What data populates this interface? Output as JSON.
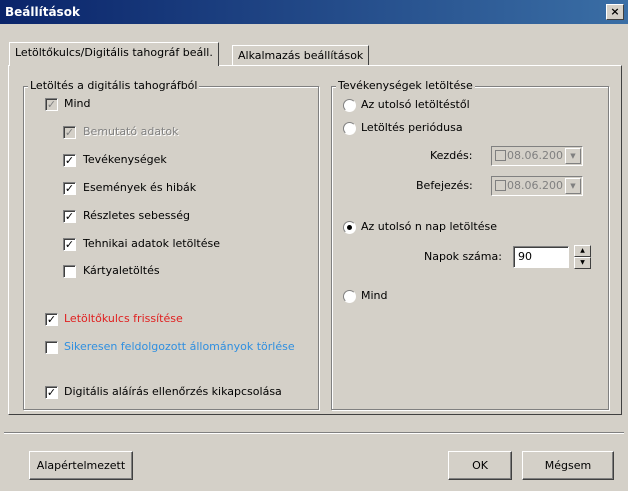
{
  "window": {
    "title": "Beállítások",
    "close_glyph": "×"
  },
  "tabs": [
    {
      "label": "Letöltőkulcs/Digitális tahográf beáll."
    },
    {
      "label": "Alkalmazás beállítások"
    }
  ],
  "left_group": {
    "legend": "Letöltés a digitális tahográfból",
    "items": [
      {
        "label": "Mind",
        "checked": true,
        "disabled": true
      },
      {
        "label": "Bemutató adatok",
        "checked": true,
        "disabled": true
      },
      {
        "label": "Tevékenységek",
        "checked": true,
        "disabled": false
      },
      {
        "label": "Események és hibák",
        "checked": true,
        "disabled": false
      },
      {
        "label": "Részletes sebesség",
        "checked": true,
        "disabled": false
      },
      {
        "label": "Tehnikai adatok letöltése",
        "checked": true,
        "disabled": false
      },
      {
        "label": "Kártyaletöltés",
        "checked": false,
        "disabled": false
      }
    ],
    "key_refresh": {
      "label": "Letöltőkulcs frissítése",
      "checked": true,
      "color": "#e02020"
    },
    "delete_processed": {
      "label": "Sikeresen feldolgozott állományok törlése",
      "checked": false,
      "color": "#2f8fe0"
    },
    "disable_signature": {
      "label": "Digitális aláírás ellenőrzés kikapcsolása",
      "checked": true
    }
  },
  "right_group": {
    "legend": "Tevékenységek letöltése",
    "radios": [
      {
        "label": "Az utolsó letöltéstől",
        "selected": false
      },
      {
        "label": "Letöltés periódusa",
        "selected": false
      },
      {
        "label": "Az utolsó n nap letöltése",
        "selected": true
      },
      {
        "label": "Mind",
        "selected": false
      }
    ],
    "start_label": "Kezdés:",
    "start_value": "08.06.200",
    "end_label": "Befejezés:",
    "end_value": "08.06.200",
    "days_label": "Napok száma:",
    "days_value": "90"
  },
  "buttons": {
    "defaults": "Alapértelmezett",
    "ok": "OK",
    "cancel": "Mégsem"
  }
}
